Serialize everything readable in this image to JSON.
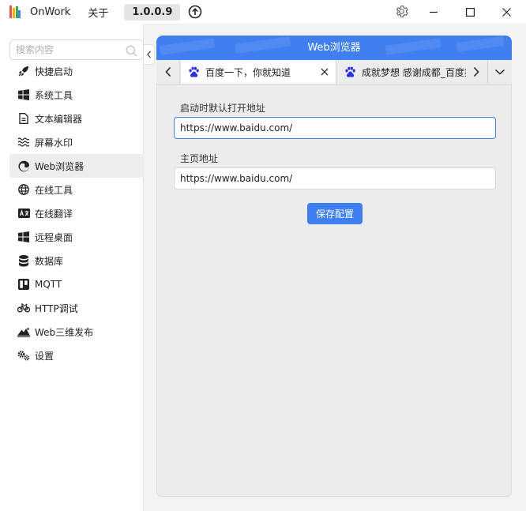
{
  "app": {
    "title": "OnWork",
    "about_label": "关于",
    "version": "1.0.0.9"
  },
  "colors": {
    "accent": "#3f7ff1",
    "baidu": "#2932e1"
  },
  "sidebar": {
    "search_placeholder": "搜索内容",
    "items": [
      {
        "label": "快捷启动",
        "icon": "rocket-icon"
      },
      {
        "label": "系统工具",
        "icon": "windows-icon"
      },
      {
        "label": "文本编辑器",
        "icon": "document-icon"
      },
      {
        "label": "屏幕水印",
        "icon": "waves-icon"
      },
      {
        "label": "Web浏览器",
        "icon": "edge-browser-icon",
        "active": true
      },
      {
        "label": "在线工具",
        "icon": "globe-icon"
      },
      {
        "label": "在线翻译",
        "icon": "translate-icon"
      },
      {
        "label": "远程桌面",
        "icon": "windows-icon"
      },
      {
        "label": "数据库",
        "icon": "database-icon"
      },
      {
        "label": "MQTT",
        "icon": "board-icon"
      },
      {
        "label": "HTTP调试",
        "icon": "bike-icon"
      },
      {
        "label": "Web三维发布",
        "icon": "mountain-icon"
      },
      {
        "label": "设置",
        "icon": "gears-icon"
      }
    ]
  },
  "main": {
    "header_title": "Web浏览器",
    "tabs": [
      {
        "label": "百度一下，你就知道",
        "icon": "baidu-paw-icon"
      },
      {
        "label": "成就梦想 感谢成都_百度搜",
        "icon": "baidu-paw-icon"
      }
    ],
    "form": {
      "startup_label": "启动时默认打开地址",
      "startup_value": "https://www.baidu.com/",
      "home_label": "主页地址",
      "home_value": "https://www.baidu.com/",
      "save_label": "保存配置"
    }
  }
}
